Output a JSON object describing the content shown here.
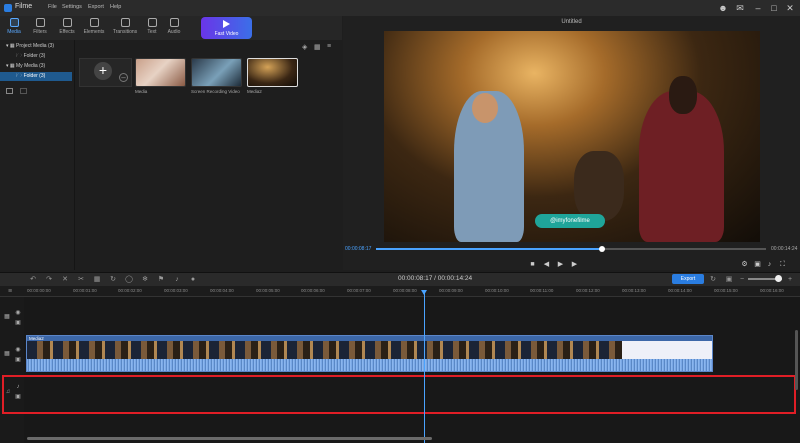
{
  "app": {
    "name": "Filme",
    "menu": [
      "File",
      "Settings",
      "Export",
      "Help"
    ],
    "window_icons": [
      "account-icon",
      "mail-icon",
      "minimize-icon",
      "maximize-icon",
      "close-icon"
    ]
  },
  "toolbar": {
    "tabs": [
      {
        "label": "Media",
        "icon": "media-icon",
        "active": true
      },
      {
        "label": "Filters",
        "icon": "filters-icon",
        "active": false
      },
      {
        "label": "Effects",
        "icon": "effects-icon",
        "active": false
      },
      {
        "label": "Elements",
        "icon": "elements-icon",
        "active": false
      },
      {
        "label": "Transitions",
        "icon": "transitions-icon",
        "active": false
      },
      {
        "label": "Text",
        "icon": "text-icon",
        "active": false
      },
      {
        "label": "Audio",
        "icon": "audio-icon",
        "active": false
      }
    ],
    "fast_video_label": "Fast Video"
  },
  "tree": {
    "items": [
      {
        "label": "Project Media (3)",
        "level": 0,
        "selected": false
      },
      {
        "label": "Folder (3)",
        "level": 1,
        "selected": false
      },
      {
        "label": "My Media (3)",
        "level": 0,
        "selected": false
      },
      {
        "label": "Folder (3)",
        "level": 1,
        "selected": true
      }
    ]
  },
  "media": {
    "items": [
      {
        "name": "Media"
      },
      {
        "name": "Screen Recording Video"
      },
      {
        "name": "Media2"
      }
    ]
  },
  "preview": {
    "title": "Untitled",
    "watermark": "@imyfonefilme",
    "current_time": "00:00:08:17",
    "duration": "00:00:14:24",
    "progress": 0.58
  },
  "timeline": {
    "time_display": "00:00:08:17 / 00:00:14:24",
    "export_label": "Export",
    "ruler": [
      "00:00:00:00",
      "00:00:01:00",
      "00:00:02:00",
      "00:00:03:00",
      "00:00:04:00",
      "00:00:05:00",
      "00:00:06:00",
      "00:00:07:00",
      "00:00:08:00",
      "00:00:09:00",
      "00:00:10:00",
      "00:00:11:00",
      "00:00:12:00",
      "00:00:13:00",
      "00:00:14:00",
      "00:00:15:00",
      "00:00:16:00"
    ],
    "clip_label": "Media2"
  },
  "colors": {
    "accent": "#2a7de1",
    "playhead": "#4aa3ff",
    "clip": "#3c67a8",
    "highlight": "#e01e26"
  }
}
